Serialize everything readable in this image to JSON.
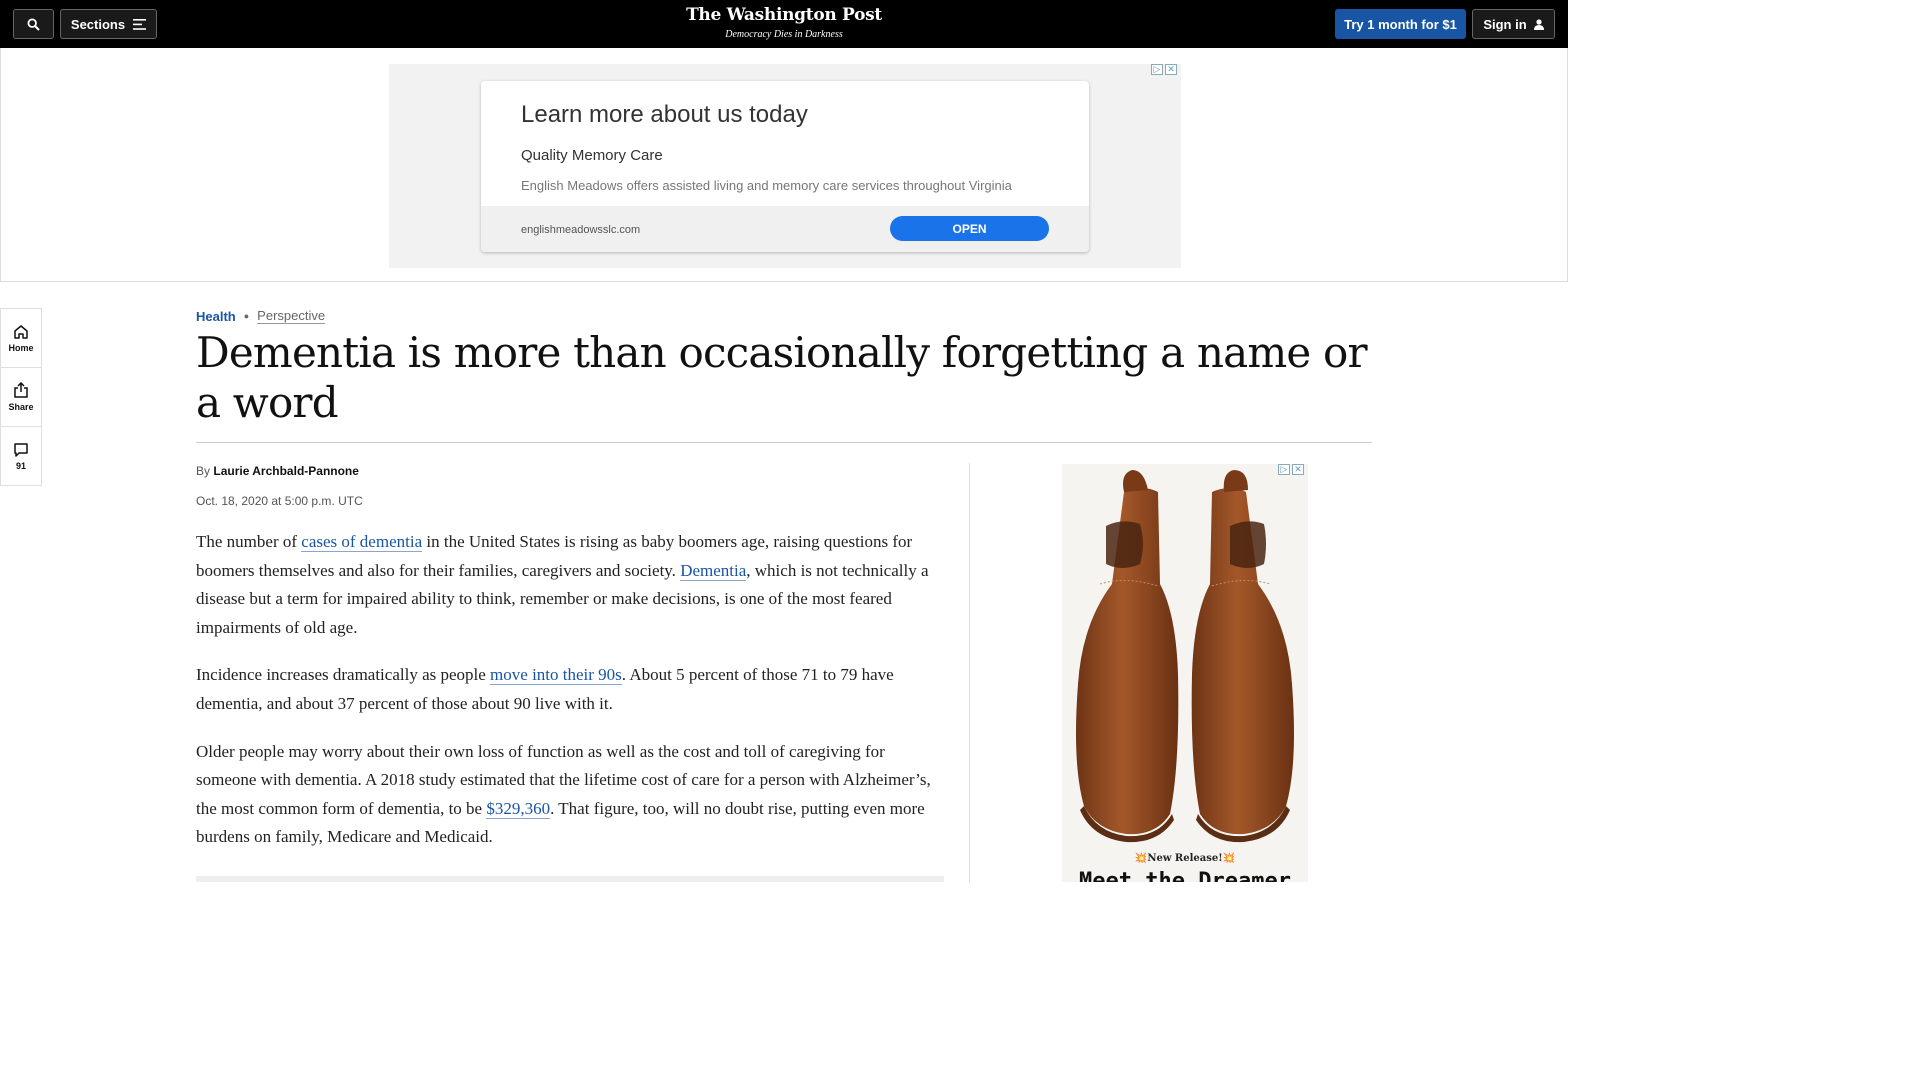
{
  "nav": {
    "sections_label": "Sections",
    "logo": "The Washington Post",
    "tagline": "Democracy Dies in Darkness",
    "try_label": "Try 1 month for $1",
    "signin_label": "Sign in"
  },
  "top_ad": {
    "headline": "Learn more about us today",
    "subhead": "Quality Memory Care",
    "description": "English Meadows offers assisted living and memory care services throughout Virginia",
    "url": "englishmeadowsslc.com",
    "cta": "OPEN"
  },
  "rail": {
    "home": "Home",
    "share": "Share",
    "comments_count": "91"
  },
  "article": {
    "section": "Health",
    "label": "Perspective",
    "headline": "Dementia is more than occasionally forgetting a name or a word",
    "by": "By",
    "author": "Laurie Archbald-Pannone",
    "date": "Oct. 18, 2020 at 5:00 p.m. UTC",
    "p1": {
      "t1": "The number of ",
      "link1": "cases of dementia",
      "t2": " in the United States is rising as baby boomers age, raising questions for boomers themselves and also for their families, caregivers and society. ",
      "link2": "Dementia",
      "t3": ", which is not technically a disease but a term for impaired ability to think, remember or make decisions, is one of the most feared impairments of old age."
    },
    "p2": {
      "t1": "Incidence increases dramatically as people ",
      "link1": "move into their 90s",
      "t2": ". About 5 percent of those 71 to 79 have dementia, and about 37 percent of those about 90 live with it."
    },
    "p3": {
      "t1": "Older people may worry about their own loss of function as well as the cost and toll of caregiving for someone with dementia. A 2018 study estimated that the lifetime cost of care for a person with Alzheimer’s, the most common form of dementia, to be ",
      "link1": "$329,360",
      "t2": ". That figure, too, will no doubt rise, putting even more burdens on family, Medicare and Medicaid."
    }
  },
  "side_ad": {
    "release": "💥New Release!💥",
    "title": "Meet the Dreamer"
  },
  "colors": {
    "brand_blue": "#1955a5",
    "nav_bg": "#000000",
    "ad_cta": "#1a73e8"
  },
  "icons": [
    "search-icon",
    "menu-icon",
    "user-icon",
    "home-icon",
    "share-icon",
    "comment-icon",
    "adchoices-icon",
    "ad-close-icon"
  ]
}
